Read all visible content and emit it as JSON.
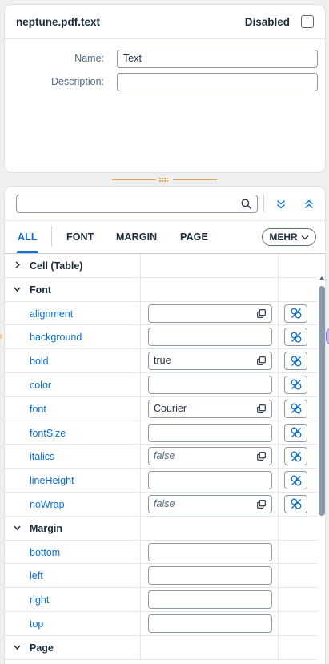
{
  "top": {
    "title": "neptune.pdf.text",
    "disabled_label": "Disabled",
    "name_label": "Name:",
    "name_value": "Text",
    "description_label": "Description:",
    "description_value": ""
  },
  "toolbar": {
    "search_placeholder": "",
    "collapse_icon": "chevrons-down-icon",
    "expand_icon": "chevrons-up-icon"
  },
  "tabs": [
    {
      "label": "ALL",
      "active": true
    },
    {
      "label": "FONT"
    },
    {
      "label": "MARGIN"
    },
    {
      "label": "PAGE"
    }
  ],
  "more_label": "MEHR",
  "groups": {
    "cell_table": "Cell (Table)",
    "font": "Font",
    "margin": "Margin",
    "page": "Page"
  },
  "font_props": [
    {
      "name": "alignment",
      "value": "",
      "copy": true
    },
    {
      "name": "background",
      "value": ""
    },
    {
      "name": "bold",
      "value": "true",
      "copy": true
    },
    {
      "name": "color",
      "value": ""
    },
    {
      "name": "font",
      "value": "Courier",
      "copy": true
    },
    {
      "name": "fontSize",
      "value": ""
    },
    {
      "name": "italics",
      "value": "false",
      "copy": true,
      "placeholder": true
    },
    {
      "name": "lineHeight",
      "value": ""
    },
    {
      "name": "noWrap",
      "value": "false",
      "copy": true,
      "placeholder": true
    }
  ],
  "margin_props": [
    {
      "name": "bottom",
      "value": ""
    },
    {
      "name": "left",
      "value": ""
    },
    {
      "name": "right",
      "value": ""
    },
    {
      "name": "top",
      "value": ""
    }
  ],
  "colors": {
    "accent": "#0a6ed1",
    "splitter": "#e8891e"
  }
}
